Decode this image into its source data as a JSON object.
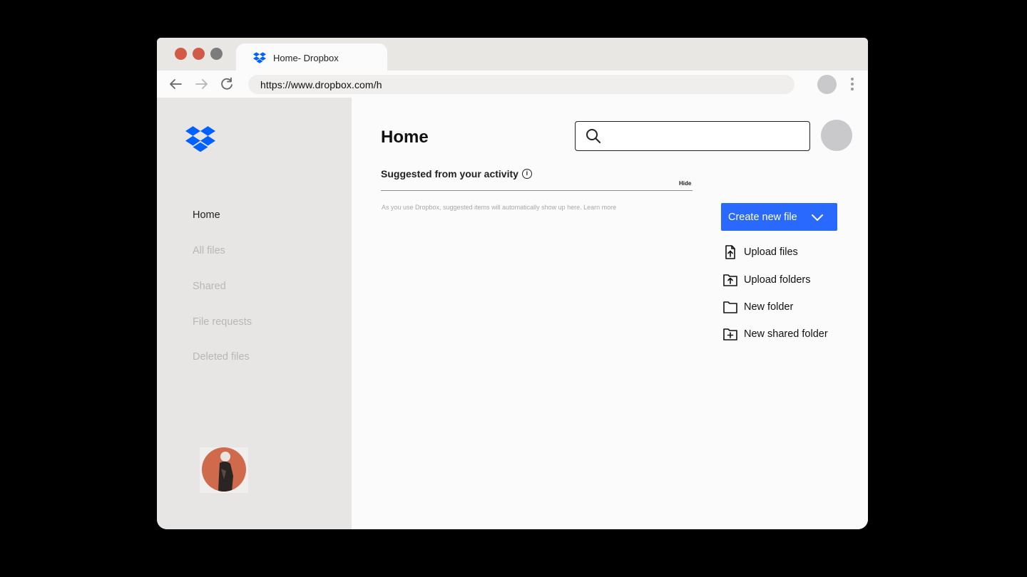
{
  "browser": {
    "window_controls": [
      {
        "name": "close",
        "color": "#d35a45"
      },
      {
        "name": "minimize",
        "color": "#cf5b48"
      },
      {
        "name": "maximize",
        "color": "#7c7c7c"
      }
    ],
    "tab_title": "Home- Dropbox",
    "url": "https://www.dropbox.com/h"
  },
  "sidebar": {
    "items": [
      {
        "label": "Home",
        "active": true
      },
      {
        "label": "All files",
        "active": false
      },
      {
        "label": "Shared",
        "active": false
      },
      {
        "label": "File requests",
        "active": false
      },
      {
        "label": "Deleted files",
        "active": false
      }
    ]
  },
  "main": {
    "title": "Home",
    "search": {
      "placeholder": ""
    },
    "suggested_title": "Suggested from your activity",
    "hide_label": "Hide",
    "hint": "As you use Dropbox, suggested items will automatically show up here. Learn more",
    "create_button": "Create new file",
    "actions": [
      {
        "label": "Upload files",
        "icon": "upload-file-icon"
      },
      {
        "label": "Upload folders",
        "icon": "upload-folder-icon"
      },
      {
        "label": "New folder",
        "icon": "folder-icon"
      },
      {
        "label": "New shared folder",
        "icon": "shared-folder-icon"
      }
    ]
  },
  "colors": {
    "accent": "#2a69fe",
    "brand": "#0061fe",
    "avatar": "#cf6a4c"
  }
}
